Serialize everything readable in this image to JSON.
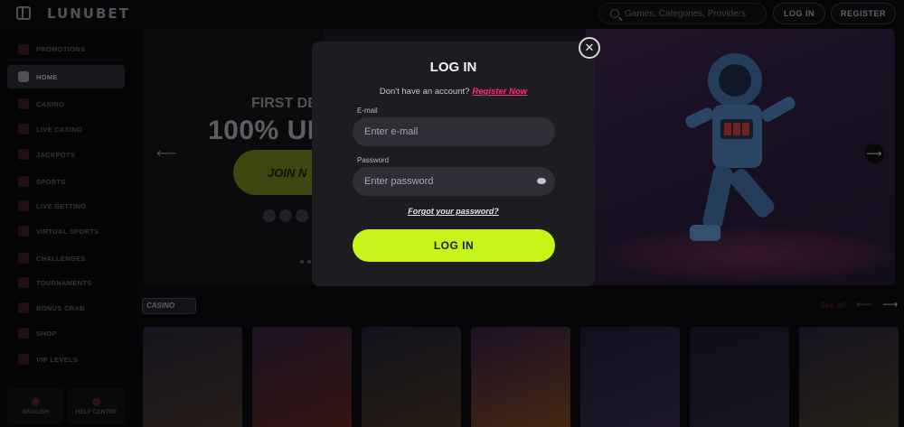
{
  "header": {
    "logo": "LUNUBET",
    "search_placeholder": "Games, Categories, Providers",
    "login_label": "LOG IN",
    "register_label": "REGISTER"
  },
  "sidebar": {
    "items": [
      {
        "label": "PROMOTIONS",
        "icon": "gift-icon"
      },
      {
        "label": "HOME",
        "icon": "home-icon"
      },
      {
        "label": "CASINO",
        "icon": "slot-machine-icon"
      },
      {
        "label": "LIVE CASINO",
        "icon": "cards-icon"
      },
      {
        "label": "JACKPOTS",
        "icon": "crown-icon"
      },
      {
        "label": "SPORTS",
        "icon": "ball-icon"
      },
      {
        "label": "LIVE BETTING",
        "icon": "live-icon"
      },
      {
        "label": "VIRTUAL SPORTS",
        "icon": "virtual-icon"
      },
      {
        "label": "CHALLENGES",
        "icon": "target-icon"
      },
      {
        "label": "TOURNAMENTS",
        "icon": "trophy-icon"
      },
      {
        "label": "BONUS CRAB",
        "icon": "crab-icon"
      },
      {
        "label": "SHOP",
        "icon": "cart-icon"
      },
      {
        "label": "VIP LEVELS",
        "icon": "diamond-icon"
      }
    ],
    "language": "ENGLISH",
    "help": "HELP CENTRE"
  },
  "banner": {
    "line1": "FIRST DEPOS",
    "line2": "100% UP",
    "cta": "JOIN N"
  },
  "casino": {
    "tag": "CASINO",
    "see_all": "See all"
  },
  "games": [
    {
      "colors": [
        "#3b3552",
        "#6a4f3f"
      ]
    },
    {
      "colors": [
        "#4a2f5f",
        "#8a3a2a"
      ]
    },
    {
      "colors": [
        "#2d3150",
        "#6b4b2d"
      ]
    },
    {
      "colors": [
        "#4a2c6a",
        "#b86a2a"
      ]
    },
    {
      "colors": [
        "#2e2950",
        "#4f3f6a"
      ]
    },
    {
      "colors": [
        "#272a44",
        "#3a3a55"
      ]
    },
    {
      "colors": [
        "#3b3358",
        "#6a5a3a"
      ]
    }
  ],
  "modal": {
    "title": "LOG IN",
    "signup_prompt": "Don't have an account?",
    "signup_link": "Register Now",
    "email_label": "E-mail",
    "email_placeholder": "Enter e-mail",
    "password_label": "Password",
    "password_placeholder": "Enter password",
    "forgot": "Forgot your password?",
    "submit": "LOG IN"
  },
  "colors": {
    "accent_green": "#c6f51c",
    "link_pink": "#ff2d78"
  }
}
